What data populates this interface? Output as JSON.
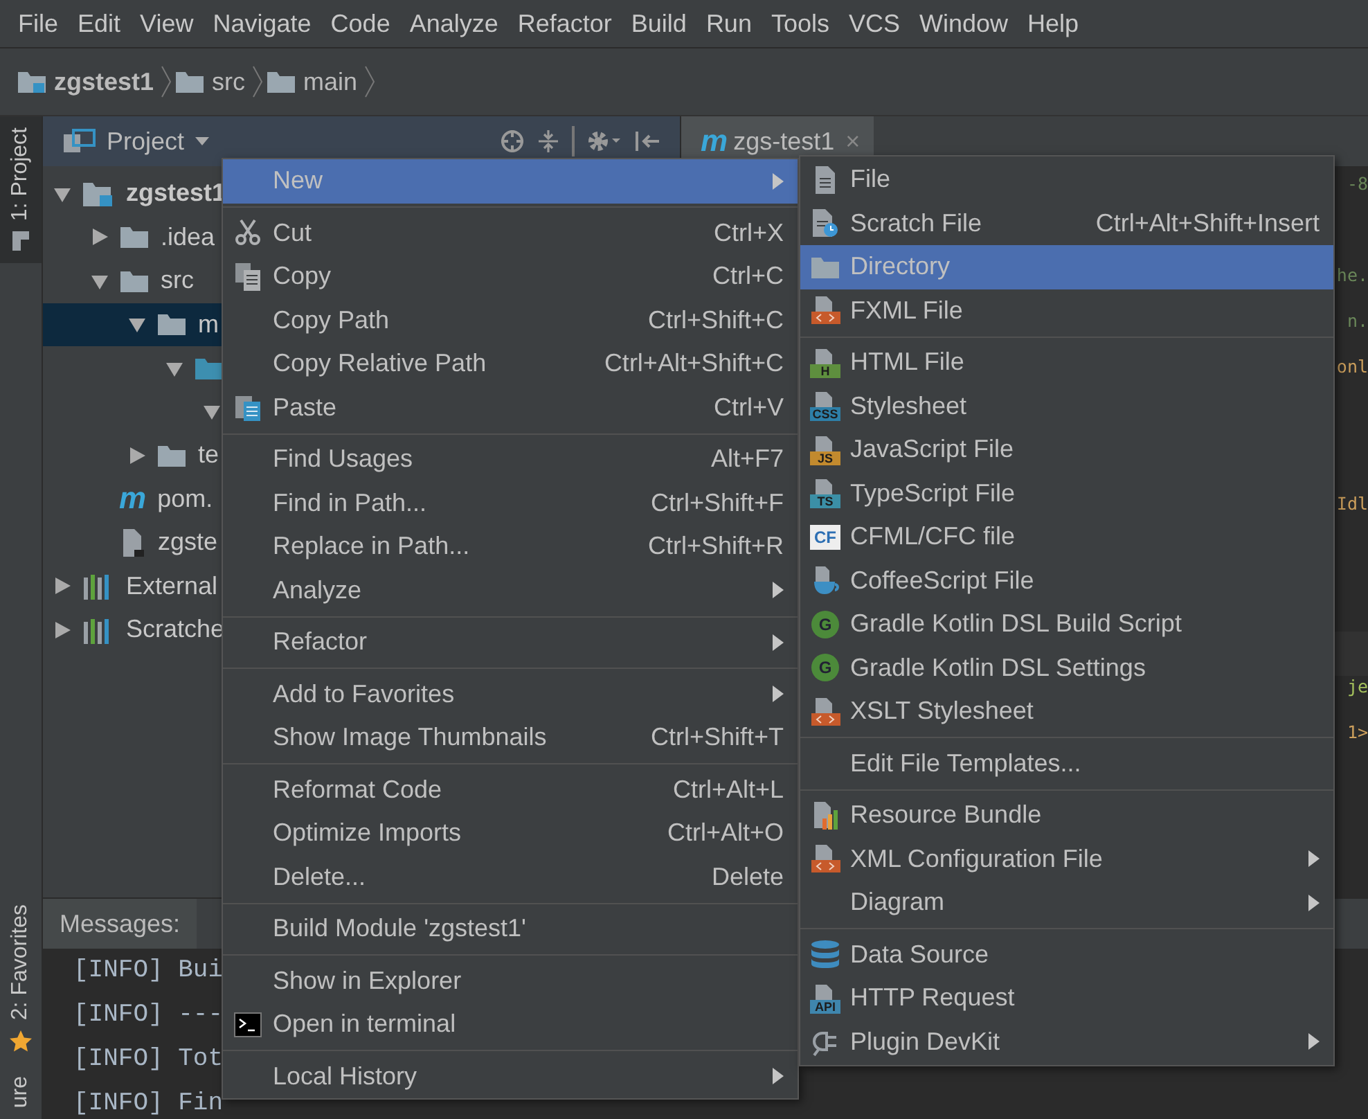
{
  "menubar": [
    {
      "label": "File"
    },
    {
      "label": "Edit"
    },
    {
      "label": "View"
    },
    {
      "label": "Navigate"
    },
    {
      "label": "Code"
    },
    {
      "label": "Analyze"
    },
    {
      "label": "Refactor"
    },
    {
      "label": "Build"
    },
    {
      "label": "Run"
    },
    {
      "label": "Tools"
    },
    {
      "label": "VCS"
    },
    {
      "label": "Window"
    },
    {
      "label": "Help"
    }
  ],
  "breadcrumb": [
    {
      "label": "zgstest1",
      "bold": true
    },
    {
      "label": "src",
      "bold": false
    },
    {
      "label": "main",
      "bold": false
    }
  ],
  "tool_strip": {
    "top": [
      {
        "label": "1: Project",
        "selected": true
      }
    ],
    "bottom": [
      {
        "label": "2: Favorites",
        "selected": false
      },
      {
        "label": "ure",
        "selected": false
      }
    ]
  },
  "project_panel": {
    "title": "Project",
    "tree": [
      {
        "label": "zgstest1",
        "bold": true,
        "expanded": true,
        "selected": false,
        "children": [
          {
            "label": ".idea",
            "expanded": false,
            "selected": false
          },
          {
            "label": "src",
            "expanded": true,
            "selected": false,
            "children": [
              {
                "label": "m",
                "expanded": true,
                "selected": true,
                "children": [
                  {
                    "expanded": true,
                    "selected": false,
                    "children": [
                      {
                        "expanded": true,
                        "selected": false
                      }
                    ]
                  }
                ]
              },
              {
                "label": "te",
                "expanded": false,
                "selected": false
              }
            ]
          },
          {
            "label": "pom.",
            "badge": "m",
            "selected": false
          },
          {
            "label": "zgste",
            "selected": false
          }
        ]
      },
      {
        "label": "External",
        "expanded": false,
        "selected": false
      },
      {
        "label": "Scratche",
        "expanded": false,
        "selected": false
      }
    ]
  },
  "editor": {
    "tab": {
      "badge": "m",
      "label": "zgs-test1",
      "close": "×"
    },
    "lines": [
      {
        "text": "-8",
        "color": "#6a8759"
      },
      {
        "text": "he.",
        "color": "#6a8759"
      },
      {
        "text": "n.",
        "color": "#6a8759"
      },
      {
        "text": "onl",
        "color": "#cc9f5c"
      },
      {
        "text": "Idl",
        "color": "#cc9f5c"
      },
      {
        "text": "je",
        "color": "#a5c25c"
      },
      {
        "text": "1>",
        "color": "#cc9f5c"
      }
    ]
  },
  "messages": {
    "tabs": [
      {
        "label": "Messages:"
      }
    ],
    "lines": [
      "[INFO] Bui",
      "[INFO] ---",
      "[INFO] Tot",
      "[INFO] Fin"
    ]
  },
  "context_menu": [
    [
      {
        "label": "New",
        "selected": true,
        "submenu": true
      }
    ],
    [
      {
        "label": "Cut",
        "shortcut": "Ctrl+X",
        "selected": false,
        "submenu": false
      },
      {
        "label": "Copy",
        "shortcut": "Ctrl+C",
        "selected": false,
        "submenu": false
      },
      {
        "label": "Copy Path",
        "shortcut": "Ctrl+Shift+C",
        "selected": false,
        "submenu": false
      },
      {
        "label": "Copy Relative Path",
        "shortcut": "Ctrl+Alt+Shift+C",
        "selected": false,
        "submenu": false
      },
      {
        "label": "Paste",
        "shortcut": "Ctrl+V",
        "selected": false,
        "submenu": false
      }
    ],
    [
      {
        "label": "Find Usages",
        "shortcut": "Alt+F7",
        "selected": false,
        "submenu": false
      },
      {
        "label": "Find in Path...",
        "shortcut": "Ctrl+Shift+F",
        "selected": false,
        "submenu": false
      },
      {
        "label": "Replace in Path...",
        "shortcut": "Ctrl+Shift+R",
        "selected": false,
        "submenu": false
      },
      {
        "label": "Analyze",
        "selected": false,
        "submenu": true
      }
    ],
    [
      {
        "label": "Refactor",
        "selected": false,
        "submenu": true
      }
    ],
    [
      {
        "label": "Add to Favorites",
        "selected": false,
        "submenu": true
      },
      {
        "label": "Show Image Thumbnails",
        "shortcut": "Ctrl+Shift+T",
        "selected": false,
        "submenu": false
      }
    ],
    [
      {
        "label": "Reformat Code",
        "shortcut": "Ctrl+Alt+L",
        "selected": false,
        "submenu": false
      },
      {
        "label": "Optimize Imports",
        "shortcut": "Ctrl+Alt+O",
        "selected": false,
        "submenu": false
      },
      {
        "label": "Delete...",
        "shortcut": "Delete",
        "selected": false,
        "submenu": false
      }
    ],
    [
      {
        "label": "Build Module 'zgstest1'",
        "selected": false,
        "submenu": false
      }
    ],
    [
      {
        "label": "Show in Explorer",
        "selected": false,
        "submenu": false
      },
      {
        "label": "Open in terminal",
        "selected": false,
        "submenu": false
      }
    ],
    [
      {
        "label": "Local History",
        "selected": false,
        "submenu": true
      }
    ]
  ],
  "new_submenu": [
    [
      {
        "label": "File",
        "selected": false,
        "submenu": false
      },
      {
        "label": "Scratch File",
        "shortcut": "Ctrl+Alt+Shift+Insert",
        "selected": false,
        "submenu": false
      },
      {
        "label": "Directory",
        "selected": true,
        "submenu": false
      },
      {
        "label": "FXML File",
        "selected": false,
        "submenu": false
      }
    ],
    [
      {
        "label": "HTML File",
        "icon_label": "H",
        "selected": false,
        "submenu": false
      },
      {
        "label": "Stylesheet",
        "icon_label": "CSS",
        "selected": false,
        "submenu": false
      },
      {
        "label": "JavaScript File",
        "icon_label": "JS",
        "selected": false,
        "submenu": false
      },
      {
        "label": "TypeScript File",
        "icon_label": "TS",
        "selected": false,
        "submenu": false
      },
      {
        "label": "CFML/CFC file",
        "icon_label": "CF",
        "selected": false,
        "submenu": false
      },
      {
        "label": "CoffeeScript File",
        "selected": false,
        "submenu": false
      },
      {
        "label": "Gradle Kotlin DSL Build Script",
        "icon_label": "G",
        "selected": false,
        "submenu": false
      },
      {
        "label": "Gradle Kotlin DSL Settings",
        "icon_label": "G",
        "selected": false,
        "submenu": false
      },
      {
        "label": "XSLT Stylesheet",
        "selected": false,
        "submenu": false
      }
    ],
    [
      {
        "label": "Edit File Templates...",
        "selected": false,
        "submenu": false
      }
    ],
    [
      {
        "label": "Resource Bundle",
        "selected": false,
        "submenu": false
      },
      {
        "label": "XML Configuration File",
        "selected": false,
        "submenu": true
      },
      {
        "label": "Diagram",
        "selected": false,
        "submenu": true
      }
    ],
    [
      {
        "label": "Data Source",
        "selected": false,
        "submenu": false
      },
      {
        "label": "HTTP Request",
        "icon_label": "API",
        "selected": false,
        "submenu": false
      },
      {
        "label": "Plugin DevKit",
        "selected": false,
        "submenu": true
      }
    ]
  ]
}
